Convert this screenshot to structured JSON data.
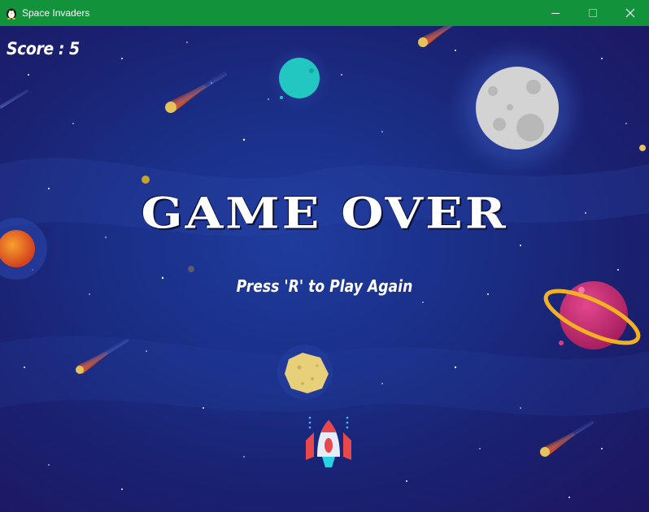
{
  "window": {
    "title": "Space Invaders",
    "icon": "linux-penguin-icon",
    "titlebar_color": "#11923b",
    "controls": [
      "minimize",
      "maximize",
      "close"
    ]
  },
  "game": {
    "score_label": "Score : 5",
    "score": 5,
    "state": "game-over",
    "headline": "GAME OVER",
    "prompt": "Press 'R' to Play Again",
    "player": "player-spaceship",
    "background_objects": [
      "moon",
      "teal-planet",
      "orange-planet",
      "ringed-pink-planet",
      "asteroid",
      "comets",
      "stars"
    ]
  },
  "colors": {
    "sky_center": "#1f3c9e",
    "sky_edge": "#1d1660",
    "text": "#ffffff"
  }
}
